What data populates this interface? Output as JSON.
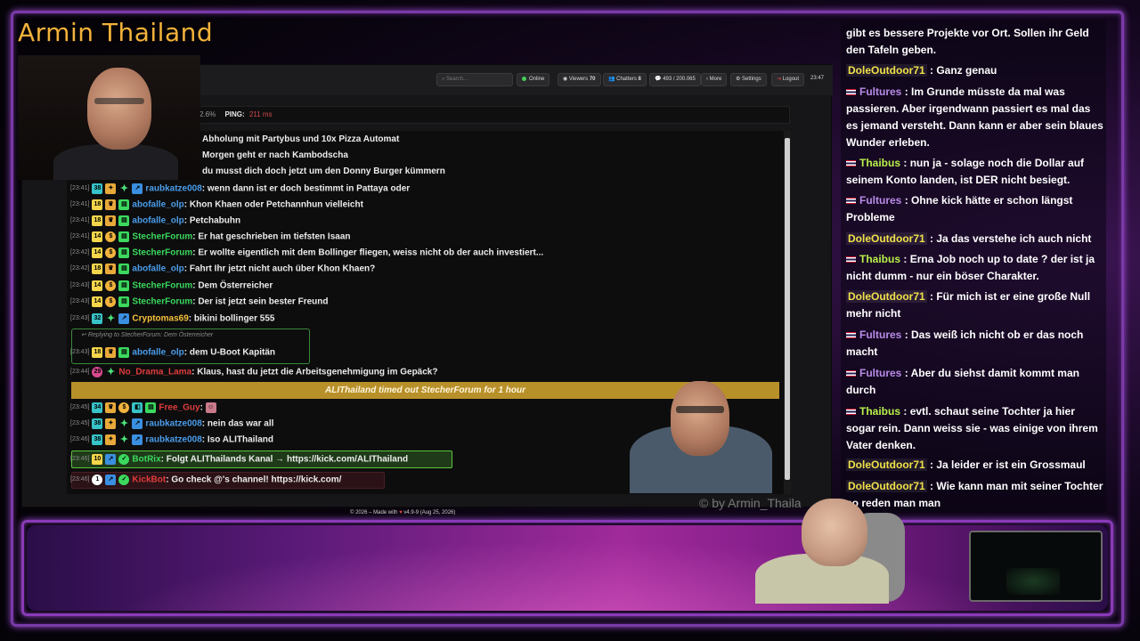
{
  "channel": {
    "title": "Armin Thailand",
    "watermark": "© by Armin_Thaila"
  },
  "toolbar": {
    "search_placeholder": "Search...",
    "online_label": "Online",
    "viewers_label": "Viewers",
    "viewers_count": "70",
    "chatters_label": "Chatters",
    "chatters_count": "8",
    "messages_count": "493 / 200.065",
    "more_label": "More",
    "settings_label": "Settings",
    "logout_label": "Logout",
    "clock": "23:47"
  },
  "stats": {
    "percent": "2.6%",
    "ping_label": "PING:",
    "ping_value": "211 ms"
  },
  "chat": {
    "partial_lines": [
      "Abholung mit Partybus und 10x Pizza Automat",
      "Morgen geht er nach Kambodscha",
      "du musst dich doch jetzt um den Donny Burger kümmern"
    ],
    "messages": [
      {
        "time": "[23:41]",
        "badge_num": "38",
        "user": "raubkatze008",
        "text": "wenn dann ist er doch bestimmt in Pattaya oder"
      },
      {
        "time": "[23:41]",
        "badge_num": "18",
        "user": "abofalle_olp",
        "text": "Khon Khaen oder Petchannhun vielleicht"
      },
      {
        "time": "[23:41]",
        "badge_num": "18",
        "user": "abofalle_olp",
        "text": "Petchabuhn"
      },
      {
        "time": "[23:41]",
        "badge_num": "14",
        "user": "StecherForum",
        "text": "Er hat geschrieben im tiefsten Isaan"
      },
      {
        "time": "[23:42]",
        "badge_num": "14",
        "user": "StecherForum",
        "text": "Er wollte eigentlich mit dem Bollinger fliegen, weiss nicht ob der auch investiert..."
      },
      {
        "time": "[23:42]",
        "badge_num": "18",
        "user": "abofalle_olp",
        "text": "Fahrt Ihr jetzt nicht auch über Khon Khaen?"
      },
      {
        "time": "[23:43]",
        "badge_num": "14",
        "user": "StecherForum",
        "text": "Dem Österreicher"
      },
      {
        "time": "[23:43]",
        "badge_num": "14",
        "user": "StecherForum",
        "text": "Der ist jetzt sein bester Freund"
      },
      {
        "time": "[23:43]",
        "badge_num": "32",
        "user": "Cryptomas69",
        "text": "bikini bollinger 555"
      },
      {
        "time": "[23:43]",
        "badge_num": "18",
        "user": "abofalle_olp",
        "text": "dem U-Boot Kapitän"
      },
      {
        "time": "[23:44]",
        "badge_num": "29",
        "user": "No_Drama_Lama",
        "text": "Klaus, hast du jetzt die Arbeitsgenehmigung im Gepäck?"
      },
      {
        "time": "[23:45]",
        "badge_num": "34",
        "user": "Free_Guy",
        "text": ""
      },
      {
        "time": "[23:45]",
        "badge_num": "38",
        "user": "raubkatze008",
        "text": "nein das war all"
      },
      {
        "time": "[23:46]",
        "badge_num": "38",
        "user": "raubkatze008",
        "text": "Iso ALIThailand"
      },
      {
        "time": "[23:46]",
        "badge_num": "10",
        "user": "BotRix",
        "text": "Folgt ALIThailands Kanal → https://kick.com/ALIThailand"
      },
      {
        "time": "[23:46]",
        "badge_num": "1",
        "user": "KickBot",
        "text": "Go check @'s channel! https://kick.com/"
      }
    ],
    "reply_header": "Replying to StecherForum: Dem Österreicher",
    "timeout_notice": "ALIThailand timed out StecherForum for 1 hour"
  },
  "footer": {
    "left": "© 2026 – Made with",
    "right": "v4.9-9 (Aug 25, 2026)"
  },
  "side_chat": [
    {
      "user": "",
      "text": "gibt es bessere Projekte vor Ort. Sollen ihr Geld den Tafeln geben."
    },
    {
      "user": "DoleOutdoor71",
      "text": ": Ganz genau"
    },
    {
      "user": "Fultures",
      "text": ": Im Grunde müsste da mal was passieren. Aber irgendwann passiert es mal das es jemand versteht. Dann kann er aber sein blaues Wunder erleben."
    },
    {
      "user": "Thaibus",
      "text": ": nun ja - solage noch die Dollar auf seinem Konto landen, ist DER nicht besiegt."
    },
    {
      "user": "Fultures",
      "text": ": Ohne kick hätte er schon längst Probleme"
    },
    {
      "user": "DoleOutdoor71",
      "text": ": Ja das verstehe ich auch nicht"
    },
    {
      "user": "Thaibus",
      "text": ": Erna Job noch up to date ? der ist ja nicht dumm - nur ein böser Charakter."
    },
    {
      "user": "DoleOutdoor71",
      "text": ": Für mich ist er eine große Null mehr nicht"
    },
    {
      "user": "Fultures",
      "text": ": Das weiß ich nicht ob er das noch macht"
    },
    {
      "user": "Fultures",
      "text": ": Aber du siehst damit kommt man durch"
    },
    {
      "user": "Thaibus",
      "text": ": evtl. schaut seine Tochter ja hier sogar rein. Dann weiss sie - was einige von ihrem Vater denken."
    },
    {
      "user": "DoleOutdoor71",
      "text": ": Ja leider er ist ein Grossmaul"
    },
    {
      "user": "DoleOutdoor71",
      "text": ": Wie kann man mit seiner Tochter so reden man man"
    }
  ],
  "colors": {
    "accent": "#f3b23b",
    "frame": "#7a3aa8",
    "online": "#45d058"
  }
}
